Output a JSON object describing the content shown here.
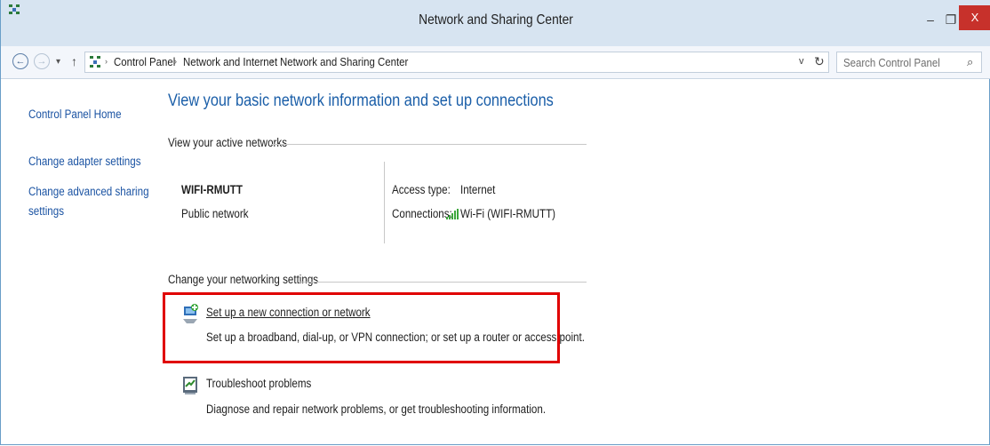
{
  "window": {
    "title": "Network and Sharing Center",
    "minimize_glyph": "–",
    "maximize_glyph": "❐",
    "close_glyph": "X"
  },
  "nav": {
    "back_glyph": "←",
    "forward_glyph": "→",
    "recent_glyph": "▾",
    "up_glyph": "↑",
    "breadcrumbs": [
      "Control Panel",
      "Network and Internet",
      "Network and Sharing Center"
    ],
    "crumb_separator": "›",
    "dropdown_glyph": "v",
    "refresh_glyph": "↻",
    "search_placeholder": "Search Control Panel",
    "search_glyph": "⌕"
  },
  "sidebar": {
    "items": [
      "Control Panel Home",
      "Change adapter settings",
      "Change advanced sharing",
      "settings"
    ]
  },
  "main": {
    "heading": "View your basic network information and set up connections",
    "active_networks_label": "View your active networks",
    "network": {
      "name": "WIFI-RMUTT",
      "type": "Public network",
      "access_type_label": "Access type:",
      "access_type_value": "Internet",
      "connections_label": "Connections:",
      "connections_value": "Wi-Fi (WIFI-RMUTT)"
    },
    "change_settings_label": "Change your networking settings",
    "actions": [
      {
        "title": "Set up a new connection or network",
        "description": "Set up a broadband, dial-up, or VPN connection; or set up a router or access point."
      },
      {
        "title": "Troubleshoot problems",
        "description": "Diagnose and repair network problems, or get troubleshooting information."
      }
    ]
  },
  "colors": {
    "link": "#1c54a3",
    "heading": "#1a5ea8",
    "highlight_box": "#e00000",
    "close_button": "#c7312b"
  }
}
